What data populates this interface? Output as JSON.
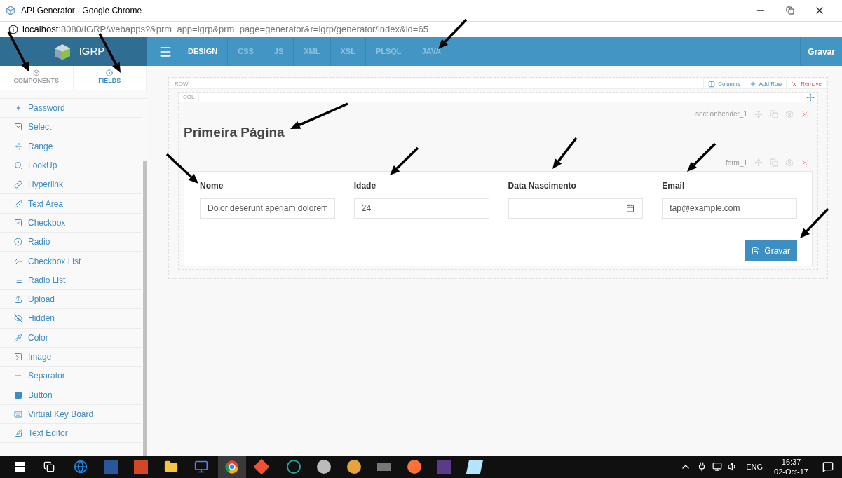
{
  "window": {
    "title": "API Generator - Google Chrome"
  },
  "address": {
    "host": "localhost",
    "path": ":8080/IGRP/webapps?&prm_app=igrp&prm_page=generator&r=igrp/generator/index&id=65"
  },
  "app": {
    "logo": "IGRP",
    "tabs": [
      {
        "label": "DESIGN",
        "selected": true
      },
      {
        "label": "CSS",
        "selected": false
      },
      {
        "label": "JS",
        "selected": false
      },
      {
        "label": "XML",
        "selected": false
      },
      {
        "label": "XSL",
        "selected": false
      },
      {
        "label": "PLSQL",
        "selected": false
      },
      {
        "label": "JAVA",
        "selected": false
      }
    ],
    "save": "Gravar"
  },
  "sidebar": {
    "tabs": [
      {
        "label": "COMPONENTS",
        "kind": "components",
        "selected": false
      },
      {
        "label": "FIELDS",
        "kind": "fields",
        "selected": true
      }
    ],
    "items": [
      {
        "label": "Password",
        "kind": "password"
      },
      {
        "label": "Select",
        "kind": "select"
      },
      {
        "label": "Range",
        "kind": "range"
      },
      {
        "label": "LookUp",
        "kind": "lookup"
      },
      {
        "label": "Hyperlink",
        "kind": "hyperlink"
      },
      {
        "label": "Text Area",
        "kind": "textarea"
      },
      {
        "label": "Checkbox",
        "kind": "checkbox"
      },
      {
        "label": "Radio",
        "kind": "radio"
      },
      {
        "label": "Checkbox List",
        "kind": "checkboxlist"
      },
      {
        "label": "Radio List",
        "kind": "radiolist"
      },
      {
        "label": "Upload",
        "kind": "upload"
      },
      {
        "label": "Hidden",
        "kind": "hidden"
      },
      {
        "label": "Color",
        "kind": "color"
      },
      {
        "label": "Image",
        "kind": "image"
      },
      {
        "label": "Separator",
        "kind": "separator"
      },
      {
        "label": "Button",
        "kind": "button"
      },
      {
        "label": "Virtual Key Board",
        "kind": "keyboard"
      },
      {
        "label": "Text Editor",
        "kind": "editor"
      }
    ]
  },
  "canvas": {
    "row_label": "ROW",
    "toolbar": [
      {
        "label": "Columns",
        "kind": "columns"
      },
      {
        "label": "Add Row",
        "kind": "add"
      },
      {
        "label": "Remove",
        "kind": "remove"
      }
    ],
    "col_label": "COL",
    "section": {
      "name": "sectionheader_1",
      "title": "Primeira Página"
    },
    "form": {
      "name": "form_1",
      "fields": [
        {
          "label": "Nome",
          "kind": "text",
          "value": "Dolor deserunt aperiam dolorem"
        },
        {
          "label": "Idade",
          "kind": "number",
          "value": "24"
        },
        {
          "label": "Data Nascimento",
          "kind": "date"
        },
        {
          "label": "Email",
          "kind": "email",
          "value": "tap@example.com"
        }
      ],
      "button": "Gravar"
    }
  },
  "taskbar": {
    "language": "ENG",
    "time": "16:37",
    "date": "02-Oct-17"
  }
}
